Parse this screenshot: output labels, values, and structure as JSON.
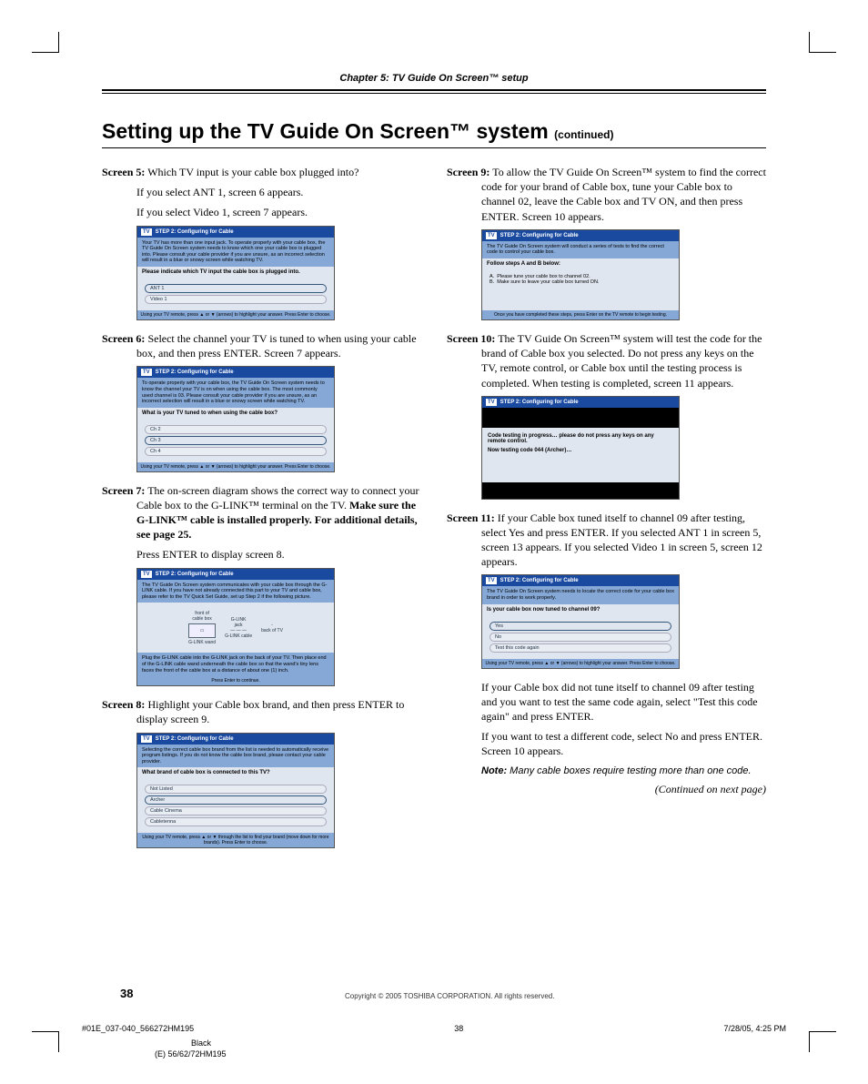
{
  "chapter_header": "Chapter 5: TV Guide On Screen™ setup",
  "title_main": "Setting up the TV Guide On Screen™ system ",
  "title_cont": "(continued)",
  "left": {
    "s5": {
      "lead": "Screen 5:",
      "text": " Which TV input is your cable box plugged into?",
      "l2": "If you select ANT 1, screen 6 appears.",
      "l3": "If you select Video 1, screen 7 appears."
    },
    "sh5": {
      "title": "STEP 2: Configuring for Cable",
      "note": "Your TV has more than one input jack. To operate properly with your cable box, the TV Guide On Screen system needs to know which one your cable box is plugged into. Please consult your cable provider if you are unsure, as an incorrect selection will result in a blue or snowy screen while watching TV.",
      "q": "Please indicate which TV input the cable box is plugged into.",
      "opts": [
        "ANT 1",
        "Video 1"
      ],
      "foot": "Using your TV remote, press ▲ or ▼ (arrows) to highlight your answer. Press Enter to choose."
    },
    "s6": {
      "lead": "Screen 6:",
      "text": " Select the channel your TV is tuned to when using your cable box, and then press ENTER. Screen 7 appears."
    },
    "sh6": {
      "title": "STEP 2: Configuring for Cable",
      "note": "To operate properly with your cable box, the TV Guide On Screen system needs to know the channel your TV is on when using the cable box. The most commonly used channel is 03. Please consult your cable provider if you are unsure, as an incorrect selection will result in a blue or snowy screen while watching TV.",
      "q": "What is your TV tuned to when using the cable box?",
      "opts": [
        "Ch 2",
        "Ch 3",
        "Ch 4"
      ],
      "foot": "Using your TV remote, press ▲ or ▼ (arrows) to highlight your answer. Press Enter to choose."
    },
    "s7": {
      "lead": "Screen 7:",
      "text": " The on-screen diagram shows the correct way to connect your Cable box to the G-LINK™ terminal on the TV. ",
      "bold": "Make sure the G-LINK™ cable is installed properly. For additional details, see page 25.",
      "tail": "Press ENTER to display screen 8."
    },
    "sh7": {
      "title": "STEP 2: Configuring for Cable",
      "note": "The TV Guide On Screen system communicates with your cable box through the G-LINK cable. If you have not already connected this part to your TV and cable box, please refer to the TV Quick Set Guide, set up Step 2 if the following picture.",
      "diag": {
        "a": "front of\ncable box",
        "b": "G-LINK\njack",
        "c": "back of TV",
        "d": "G-LINK cable",
        "e": "G-LINK wand"
      },
      "note2": "Plug the G-LINK cable into the G-LINK jack on the back of your TV. Then place end of the G-LINK cable wand underneath the cable box so that the wand's tiny lens faces the front of the cable box at a distance of about one (1) inch.",
      "foot": "Press Enter to continue."
    },
    "s8": {
      "lead": "Screen 8:",
      "text": " Highlight your Cable box brand, and then press ENTER to display screen 9."
    },
    "sh8": {
      "title": "STEP 2: Configuring for Cable",
      "note": "Selecting the correct cable box brand from the list is needed to automatically receive program listings. If you do not know the cable box brand, please contact your cable provider.",
      "q": "What brand of cable box is connected to this TV?",
      "opts": [
        "Not Listed",
        "Archer",
        "Cable Cinema",
        "Cabletenna"
      ],
      "foot": "Using your TV remote, press ▲ or ▼ through the list to find your brand (move down for more brands). Press Enter to choose."
    }
  },
  "right": {
    "s9": {
      "lead": "Screen 9:",
      "text": " To allow the TV Guide On Screen™ system to find the correct code for your brand of Cable box, tune your Cable box to channel 02, leave the Cable box and TV ON, and then press ENTER. Screen 10 appears."
    },
    "sh9": {
      "title": "STEP 2: Configuring for Cable",
      "note": "The TV Guide On Screen system will conduct a series of tests to find the correct code to control your cable box.",
      "q": "Follow steps A and B below:",
      "steps": "A.  Please tune your cable box to channel 02.\nB.  Make sure to leave your cable box turned ON.",
      "foot": "Once you have completed these steps, press Enter on the TV remote to begin testing."
    },
    "s10": {
      "lead": "Screen 10:",
      "text": " The TV Guide On Screen™ system will test the code for the brand of Cable box you selected. Do not press any keys on the TV, remote control, or Cable box until the testing process is completed. When testing is completed, screen 11 appears."
    },
    "sh10": {
      "title": "STEP 2: Configuring for Cable",
      "l1": "Code testing in progress… please do not press any keys on any remote control.",
      "l2": "Now testing code 044 (Archer)…"
    },
    "s11": {
      "lead": "Screen 11:",
      "text": " If your Cable box tuned itself to channel 09 after testing, select Yes and press ENTER. If you selected ANT 1 in screen 5, screen 13 appears. If you selected Video 1 in screen 5, screen 12 appears."
    },
    "sh11": {
      "title": "STEP 2: Configuring for Cable",
      "note": "The TV Guide On Screen system needs to locate the correct code for your cable box brand in order to work properly.",
      "q": "Is your cable box now tuned to channel 09?",
      "opts": [
        "Yes",
        "No",
        "Test this code again"
      ],
      "foot": "Using your TV remote, press ▲ or ▼ (arrows) to highlight your answer. Press Enter to choose."
    },
    "after1": "If your Cable box did not tune itself to channel 09 after testing and you want to test the same code again, select \"Test this code again\" and press ENTER.",
    "after2": "If you want to test a different code, select No and press ENTER. Screen 10 appears.",
    "note_label": "Note:",
    "note_text": " Many cable boxes require testing more than one code.",
    "continued": "(Continued on next page)"
  },
  "footer": {
    "page": "38",
    "copyright": "Copyright © 2005 TOSHIBA CORPORATION. All rights reserved.",
    "file": "#01E_037-040_566272HM195",
    "mid": "38",
    "ts": "7/28/05, 4:25 PM",
    "black": "Black",
    "model": "(E) 56/62/72HM195"
  }
}
